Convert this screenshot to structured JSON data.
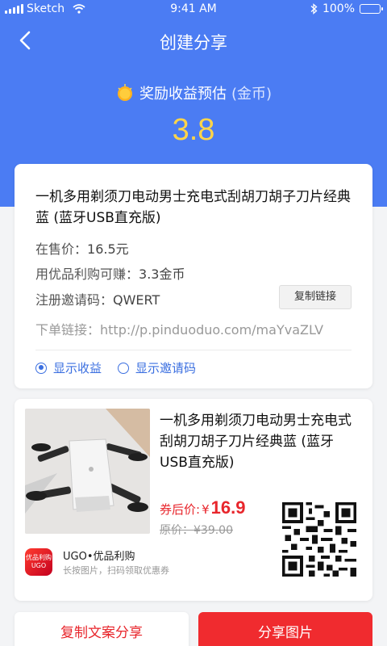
{
  "status": {
    "carrier": "Sketch",
    "time": "9:41 AM",
    "battery": "100%"
  },
  "nav": {
    "title": "创建分享"
  },
  "reward": {
    "label": "奖励收益预估",
    "unit": "(金币)",
    "value": "3.8"
  },
  "info_card": {
    "title": "一机多用剃须刀电动男士充电式刮胡刀胡子刀片经典蓝 (蓝牙USB直充版)",
    "price_label": "在售价：",
    "price_value": "16.5元",
    "earn_label": "用优品利购可赚：",
    "earn_value": "3.3金币",
    "invite_label": "注册邀请码：",
    "invite_value": "QWERT",
    "copy_link_label": "复制链接",
    "order_link_label": "下单链接：",
    "order_link_value": "http://p.pinduoduo.com/maYvaZLV",
    "option_show_earnings": "显示收益",
    "option_show_invite": "显示邀请码"
  },
  "product_card": {
    "title": "一机多用剃须刀电动男士充电式刮胡刀胡子刀片经典蓝 (蓝牙USB直充版)",
    "coupon_price_label": "券后价:",
    "coupon_price_symbol": "¥",
    "coupon_price_value": "16.9",
    "original_price": "原价：¥39.00",
    "brand_logo_text": "优品利购 UGO",
    "brand_name": "UGO•优品利购",
    "brand_hint": "长按图片，扫码领取优惠券"
  },
  "actions": {
    "copy_text_share": "复制文案分享",
    "share_image": "分享图片"
  },
  "colors": {
    "hero_blue": "#4b7cf3",
    "accent_red": "#e8262c",
    "reward_yellow": "#ffd54a",
    "link_blue": "#3b6fe0"
  },
  "icons": [
    "signal-icon",
    "wifi-icon",
    "bluetooth-icon",
    "battery-icon",
    "back-arrow-icon",
    "coin-icon",
    "radio-icon",
    "qr-code-icon"
  ]
}
